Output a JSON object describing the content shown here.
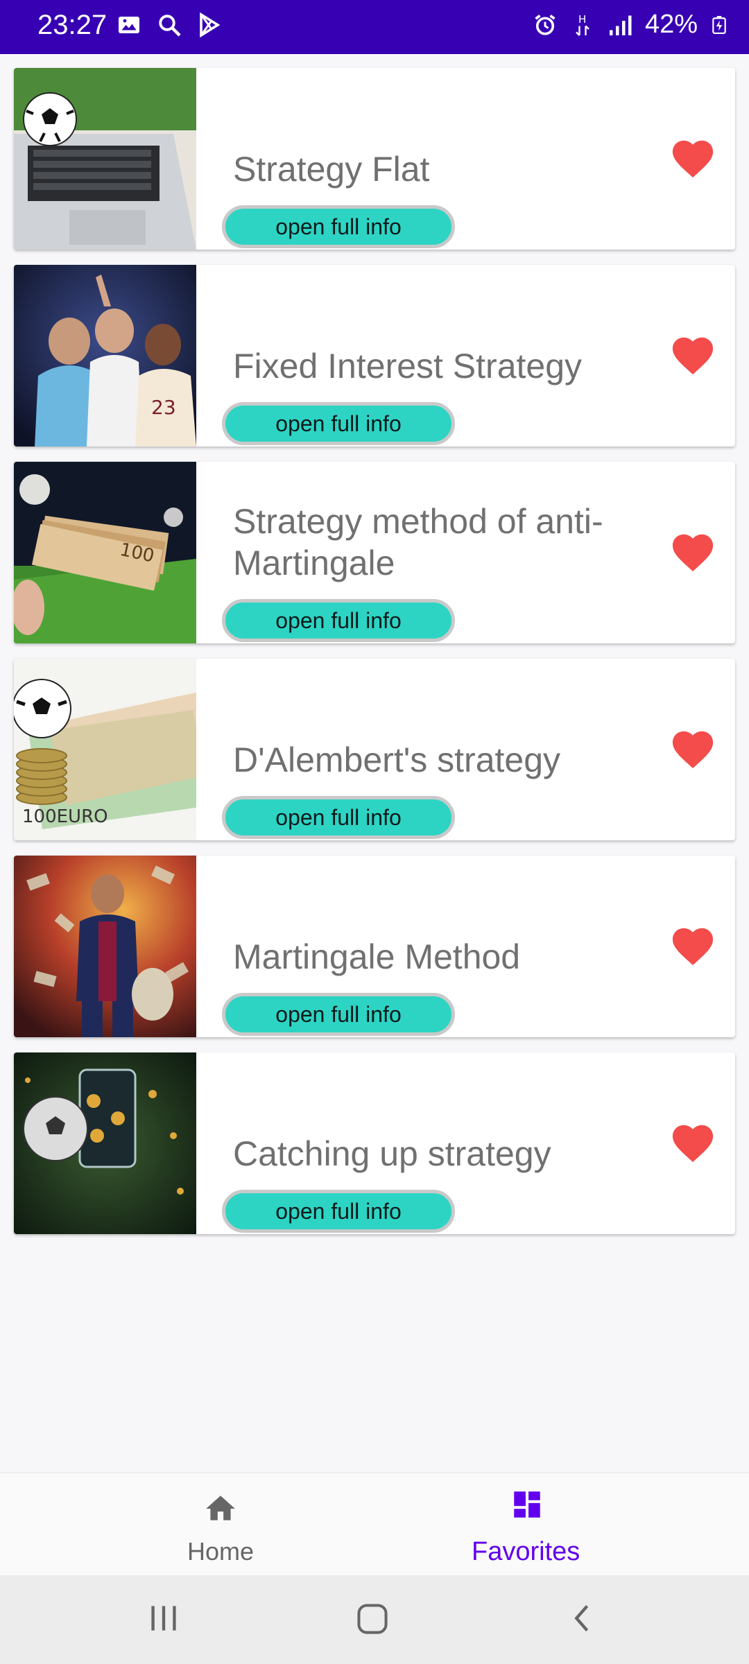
{
  "status_bar": {
    "time": "23:27",
    "battery": "42%",
    "left_icons": [
      "image-icon",
      "search-icon",
      "play-store-icon"
    ],
    "right_icons": [
      "alarm-icon",
      "network-h-icon",
      "signal-icon",
      "battery-charging-icon"
    ],
    "bg_color": "#3700b3"
  },
  "cards": [
    {
      "title": "Strategy Flat",
      "button": "open full info",
      "thumb": "laptop-football-image"
    },
    {
      "title": "Fixed Interest Strategy",
      "button": "open full info",
      "thumb": "athletes-image"
    },
    {
      "title": "Strategy method of anti-Martingale",
      "button": "open full info",
      "thumb": "money-stadium-image"
    },
    {
      "title": "D'Alembert's strategy",
      "button": "open full info",
      "thumb": "ball-coins-euro-image"
    },
    {
      "title": "Martingale Method",
      "button": "open full info",
      "thumb": "player-money-image"
    },
    {
      "title": "Catching up strategy",
      "button": "open full info",
      "thumb": "sports-betting-image"
    }
  ],
  "bottom_nav": {
    "home_label": "Home",
    "favorites_label": "Favorites",
    "active": "favorites",
    "active_color": "#6200ee",
    "inactive_color": "#666666"
  },
  "colors": {
    "heart": "#f44b4b",
    "button_bg": "#2dd4c4"
  }
}
